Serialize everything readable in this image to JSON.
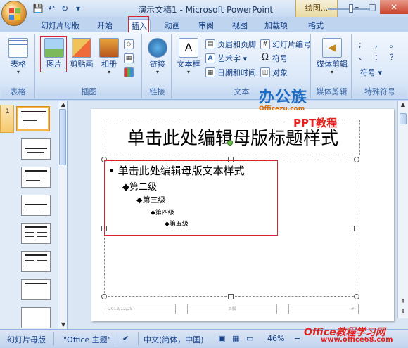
{
  "window": {
    "title": "演示文稿1 - Microsoft PowerPoint",
    "context_tool": "绘图...",
    "minimize": "–",
    "maximize": "□",
    "close": "✕"
  },
  "qat": {
    "save": "💾",
    "undo": "↶",
    "redo": "↻",
    "more": "▾"
  },
  "tabs": [
    "幻灯片母版",
    "开始",
    "插入",
    "动画",
    "审阅",
    "视图",
    "加载项",
    "格式"
  ],
  "active_tab": "插入",
  "ribbon": {
    "groups": {
      "table": {
        "label": "表格",
        "button": "表格"
      },
      "illustrations": {
        "label": "插图",
        "picture": "图片",
        "clipart": "剪贴画",
        "album": "相册"
      },
      "links": {
        "label": "链接",
        "button": "链接"
      },
      "text": {
        "label": "文本",
        "textbox": "文本框",
        "header_footer": "页眉和页脚",
        "wordart": "艺术字 ▾",
        "datetime": "日期和时间",
        "slide_number": "幻灯片编号",
        "symbol": "符号",
        "object": "对象"
      },
      "media": {
        "label": "媒体剪辑",
        "button": "媒体剪辑"
      },
      "special": {
        "label": "特殊符号",
        "symbol": "符号 ▾",
        "chars": [
          ";",
          "，",
          "。",
          "、",
          "：",
          "？"
        ]
      }
    }
  },
  "slides_panel": {
    "selected_number": "1",
    "count": 8
  },
  "slide": {
    "title": "单击此处编辑母版标题样式",
    "levels": [
      "单击此处编辑母版文本样式",
      "第二级",
      "第三级",
      "第四级",
      "第五级"
    ],
    "footer_date": "2012/12/25",
    "footer_center": "页脚",
    "footer_num": "‹#›"
  },
  "watermark": {
    "title": "办公族",
    "url": "Officezu.com",
    "sub": "PPT教程"
  },
  "statusbar": {
    "view": "幻灯片母版",
    "theme": "\"Office 主题\"",
    "language": "中文(简体，中国)",
    "zoom": "46%",
    "zoom_minus": "−",
    "zoom_plus": "+"
  },
  "bottom_watermark": {
    "line1": "Office教程学习网",
    "line2": "www.office68.com"
  },
  "colors": {
    "ribbon_bg": "#dbe8f9",
    "highlight_red": "#d9232f",
    "selected_thumb": "#f5b64c"
  }
}
